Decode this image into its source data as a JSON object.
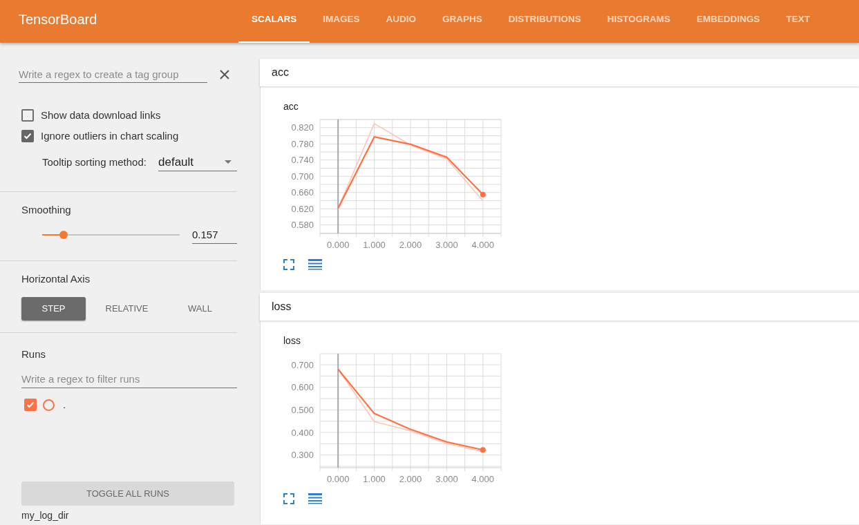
{
  "header": {
    "title": "TensorBoard",
    "tabs": [
      {
        "label": "SCALARS",
        "selected": true
      },
      {
        "label": "IMAGES",
        "selected": false
      },
      {
        "label": "AUDIO",
        "selected": false
      },
      {
        "label": "GRAPHS",
        "selected": false
      },
      {
        "label": "DISTRIBUTIONS",
        "selected": false
      },
      {
        "label": "HISTOGRAMS",
        "selected": false
      },
      {
        "label": "EMBEDDINGS",
        "selected": false
      },
      {
        "label": "TEXT",
        "selected": false
      }
    ]
  },
  "sidebar": {
    "tag_group": {
      "placeholder": "Write a regex to create a tag group"
    },
    "options": [
      {
        "label": "Show data download links",
        "checked": false
      },
      {
        "label": "Ignore outliers in chart scaling",
        "checked": true
      }
    ],
    "tooltip_sorting": {
      "label": "Tooltip sorting method:",
      "value": "default"
    },
    "smoothing": {
      "label": "Smoothing",
      "level": 0.157,
      "value": "0.157"
    },
    "horizontal_axis": {
      "label": "Horizontal Axis",
      "options": [
        {
          "label": "STEP",
          "selected": true
        },
        {
          "label": "RELATIVE",
          "selected": false
        },
        {
          "label": "WALL",
          "selected": false
        }
      ]
    },
    "runs": {
      "label": "Runs",
      "filter": {
        "placeholder": "Write a regex to filter runs"
      },
      "items": [
        {
          "label": ".",
          "checked": true,
          "color": "#ff7043"
        }
      ],
      "toggle_button": "TOGGLE ALL RUNS",
      "log_dir": "my_log_dir"
    }
  },
  "categories": [
    {
      "title": "acc",
      "cards": [
        {
          "chart_data": {
            "type": "line",
            "title": "acc",
            "x": [
              0,
              1,
              2,
              3,
              4
            ],
            "series": [
              {
                "color": "#ff7043",
                "values": [
                  0.621,
                  0.797,
                  0.779,
                  0.747,
                  0.655
                ]
              },
              {
                "color": "#ffc4b3",
                "values": [
                  0.621,
                  0.83,
                  0.777,
                  0.743,
                  0.64
                ]
              }
            ],
            "xlim": [
              -0.5,
              4.5
            ],
            "ylim": [
              0.559,
              0.84
            ],
            "xticks": [
              {
                "value": 0,
                "label": "0.000"
              },
              {
                "value": 1,
                "label": "1.000"
              },
              {
                "value": 2,
                "label": "2.000"
              },
              {
                "value": 3,
                "label": "3.000"
              },
              {
                "value": 4,
                "label": "4.000"
              }
            ],
            "yticks": [
              {
                "value": 0.58,
                "label": "0.580"
              },
              {
                "value": 0.62,
                "label": "0.620"
              },
              {
                "value": 0.66,
                "label": "0.660"
              },
              {
                "value": 0.7,
                "label": "0.700"
              },
              {
                "value": 0.74,
                "label": "0.740"
              },
              {
                "value": 0.78,
                "label": "0.780"
              },
              {
                "value": 0.82,
                "label": "0.820"
              }
            ],
            "grid": true
          }
        }
      ]
    },
    {
      "title": "loss",
      "cards": [
        {
          "chart_data": {
            "type": "line",
            "title": "loss",
            "x": [
              0,
              1,
              2,
              3,
              4
            ],
            "series": [
              {
                "color": "#ff7043",
                "values": [
                  0.68,
                  0.484,
                  0.414,
                  0.358,
                  0.323
                ]
              },
              {
                "color": "#ffc4b3",
                "values": [
                  0.68,
                  0.448,
                  0.407,
                  0.351,
                  0.315
                ]
              }
            ],
            "xlim": [
              -0.5,
              4.5
            ],
            "ylim": [
              0.244,
              0.749
            ],
            "xticks": [
              {
                "value": 0,
                "label": "0.000"
              },
              {
                "value": 1,
                "label": "1.000"
              },
              {
                "value": 2,
                "label": "2.000"
              },
              {
                "value": 3,
                "label": "3.000"
              },
              {
                "value": 4,
                "label": "4.000"
              }
            ],
            "yticks": [
              {
                "value": 0.3,
                "label": "0.300"
              },
              {
                "value": 0.4,
                "label": "0.400"
              },
              {
                "value": 0.5,
                "label": "0.500"
              },
              {
                "value": 0.6,
                "label": "0.600"
              },
              {
                "value": 0.7,
                "label": "0.700"
              }
            ],
            "grid": true
          }
        }
      ]
    }
  ]
}
